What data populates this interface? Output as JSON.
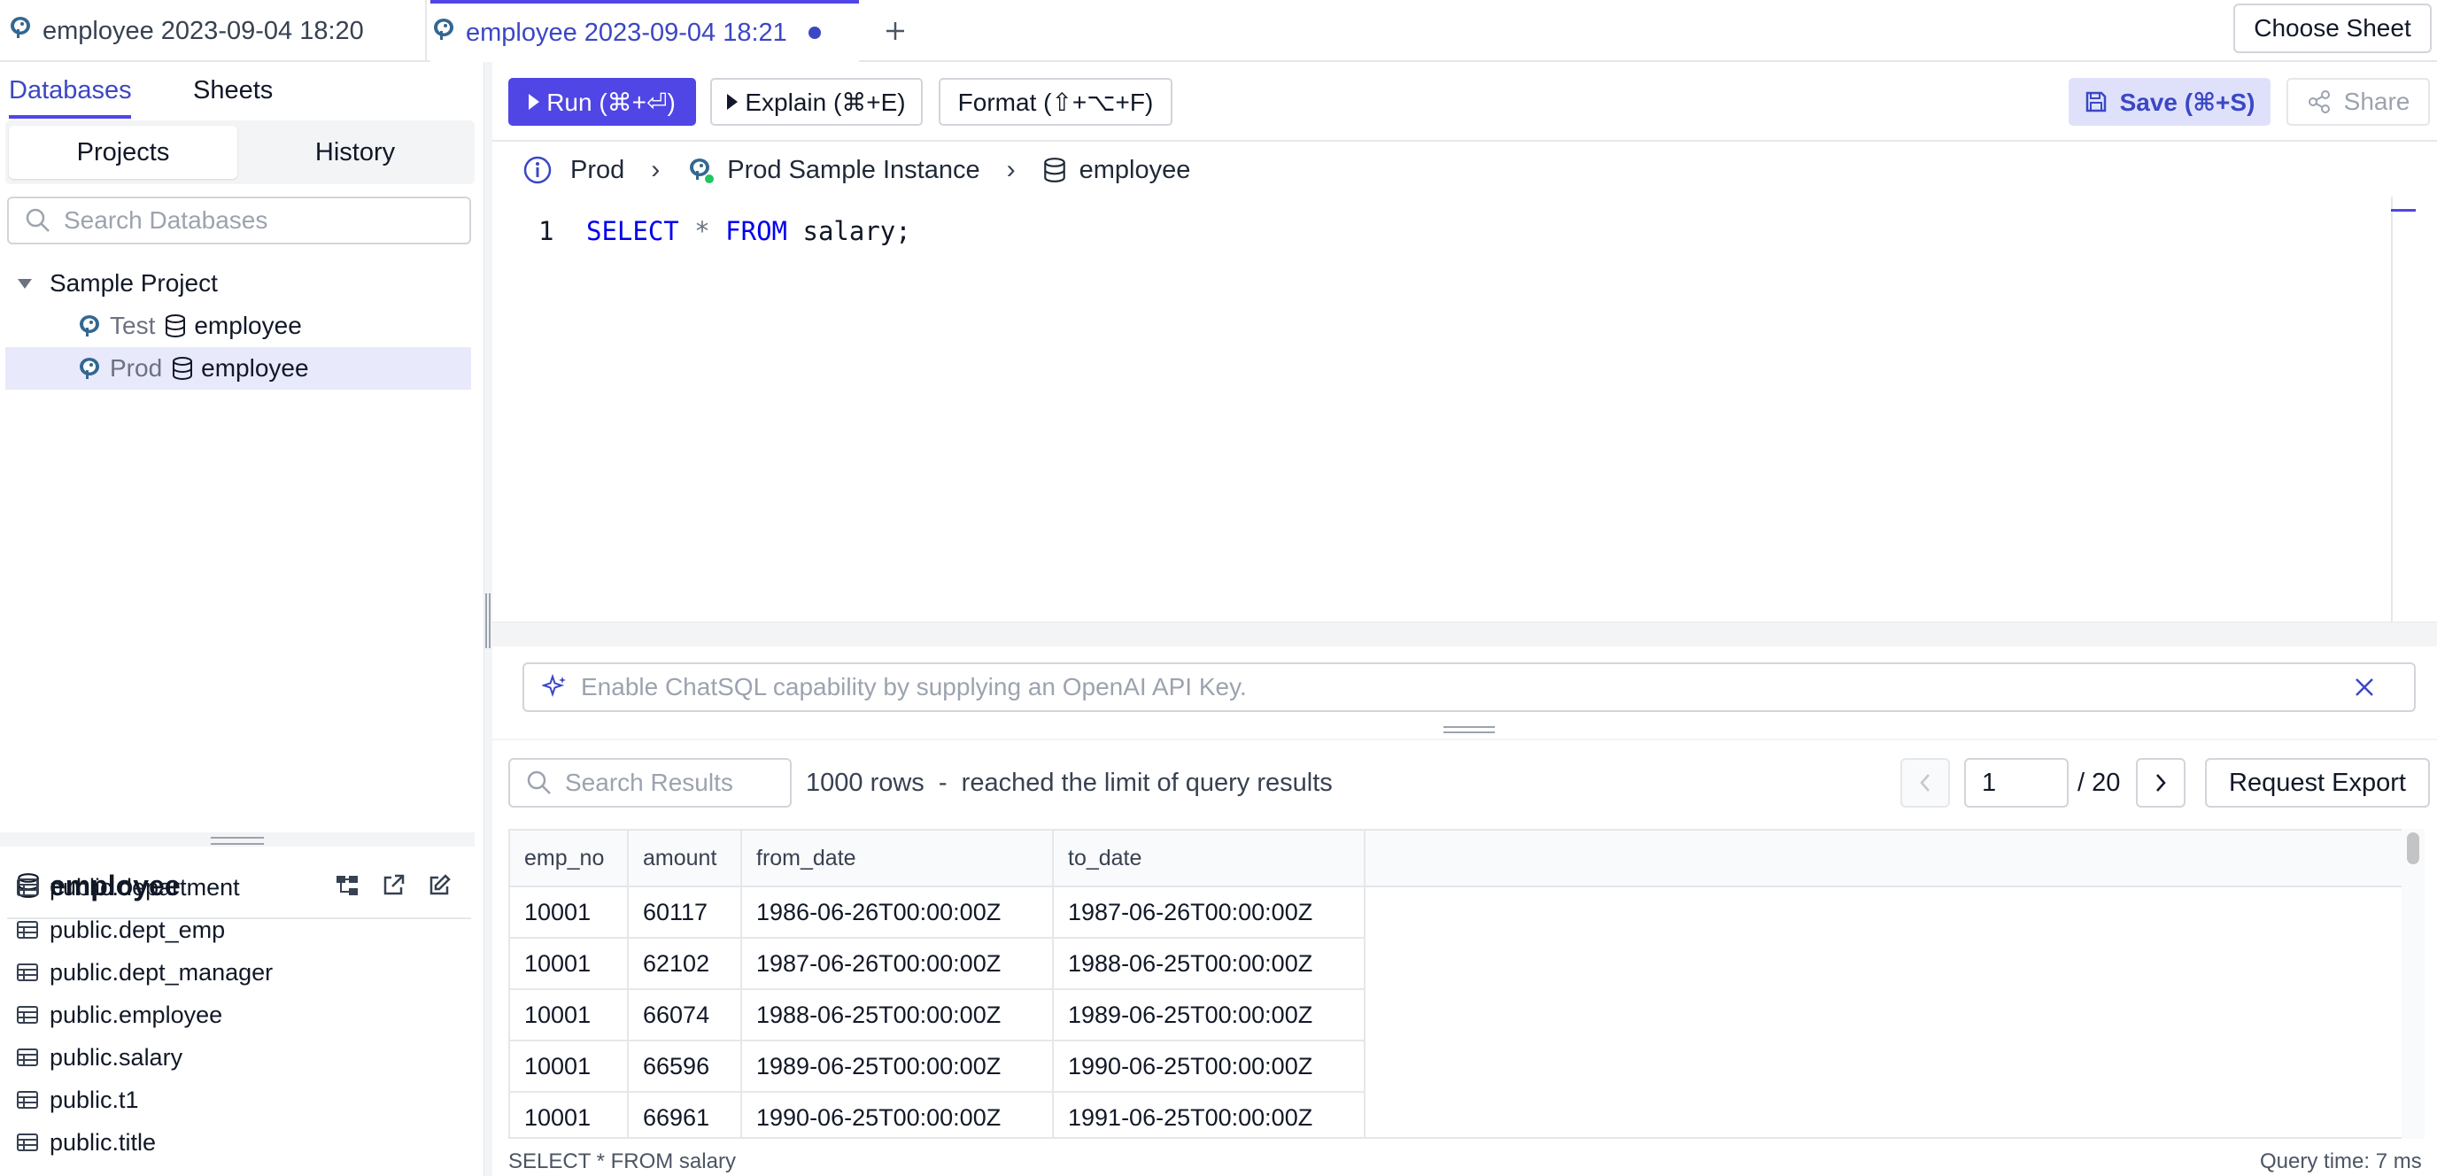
{
  "tabs": [
    {
      "label": "employee 2023-09-04 18:20",
      "active": false
    },
    {
      "label": "employee 2023-09-04 18:21",
      "active": true,
      "unsaved": true
    }
  ],
  "choose_sheet_label": "Choose Sheet",
  "sidebar": {
    "tabs": [
      "Databases",
      "Sheets"
    ],
    "segments": [
      "Projects",
      "History"
    ],
    "search_placeholder": "Search Databases",
    "project": "Sample Project",
    "instances": [
      {
        "env": "Test",
        "db": "employee",
        "selected": false
      },
      {
        "env": "Prod",
        "db": "employee",
        "selected": true
      }
    ],
    "database_title": "employee",
    "tables": [
      "public.department",
      "public.dept_emp",
      "public.dept_manager",
      "public.employee",
      "public.salary",
      "public.t1",
      "public.title"
    ]
  },
  "toolbar": {
    "run": "Run (⌘+⏎)",
    "explain": "Explain (⌘+E)",
    "format": "Format (⇧+⌥+F)",
    "save": "Save (⌘+S)",
    "share": "Share"
  },
  "breadcrumb": {
    "env": "Prod",
    "instance": "Prod Sample Instance",
    "database": "employee"
  },
  "editor": {
    "line_number": "1",
    "tokens": {
      "kw1": "SELECT",
      "star": "*",
      "kw2": "FROM",
      "rest": "salary;"
    }
  },
  "chatsql_placeholder": "Enable ChatSQL capability by supplying an OpenAI API Key.",
  "results": {
    "search_placeholder": "Search Results",
    "info": "1000 rows  -  reached the limit of query results",
    "page": "1",
    "total_pages": "/ 20",
    "export": "Request Export",
    "columns": [
      "emp_no",
      "amount",
      "from_date",
      "to_date"
    ],
    "rows": [
      [
        "10001",
        "60117",
        "1986-06-26T00:00:00Z",
        "1987-06-26T00:00:00Z"
      ],
      [
        "10001",
        "62102",
        "1987-06-26T00:00:00Z",
        "1988-06-25T00:00:00Z"
      ],
      [
        "10001",
        "66074",
        "1988-06-25T00:00:00Z",
        "1989-06-25T00:00:00Z"
      ],
      [
        "10001",
        "66596",
        "1989-06-25T00:00:00Z",
        "1990-06-25T00:00:00Z"
      ],
      [
        "10001",
        "66961",
        "1990-06-25T00:00:00Z",
        "1991-06-25T00:00:00Z"
      ]
    ]
  },
  "status": {
    "sql": "SELECT * FROM salary",
    "time": "Query time: 7 ms"
  },
  "colors": {
    "accent": "#4f46e5",
    "accent_text": "#3b47c4",
    "selection": "#e8e9fb"
  }
}
